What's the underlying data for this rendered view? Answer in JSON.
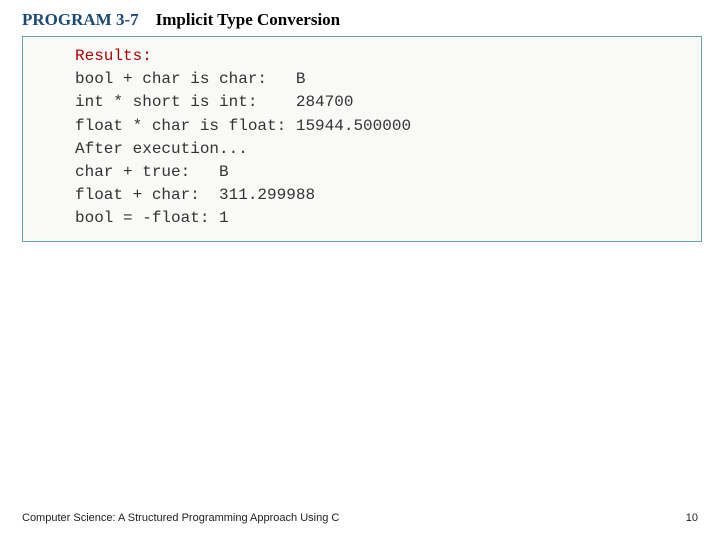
{
  "header": {
    "program_label": "PROGRAM 3-7",
    "title": "Implicit Type Conversion"
  },
  "results": {
    "keyword": "Results:",
    "lines": [
      "bool + char is char:   B",
      "int * short is int:    284700",
      "float * char is float: 15944.500000",
      "",
      "After execution...",
      "char + true:   B",
      "float + char:  311.299988",
      "bool = -float: 1"
    ]
  },
  "footer": {
    "book": "Computer Science: A Structured Programming Approach Using C",
    "page": "10"
  }
}
